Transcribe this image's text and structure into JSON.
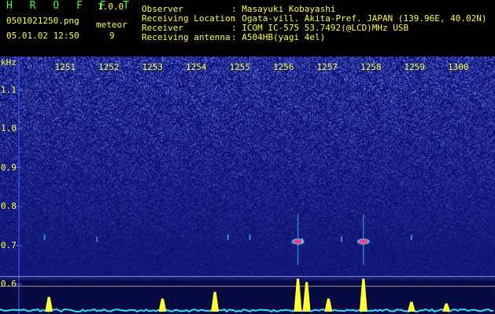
{
  "header": {
    "app_name": "H R O F F T",
    "version": "1.0.0",
    "filename": "0501021250.png",
    "datetime": "05.01.02 12:50",
    "meteor_label": "meteor",
    "meteor_count": "9"
  },
  "info": [
    {
      "label": "Observer",
      "value": ": Masayuki Kobayashi"
    },
    {
      "label": "Receiving Location",
      "value": ": Ogata-vill. Akita-Pref. JAPAN (139.96E, 40.02N)"
    },
    {
      "label": "Receiver",
      "value": ": ICOM IC-575 53.7492(@LCD)MHz USB"
    },
    {
      "label": "Receiving antenna",
      "value": ": A504HB(yagi 4el)"
    }
  ],
  "spectrogram": {
    "unit": "kHz",
    "time_ticks": [
      "1251",
      "1252",
      "1253",
      "1254",
      "1255",
      "1256",
      "1257",
      "1258",
      "1259",
      "1300"
    ],
    "freq_ticks": [
      {
        "label": "1.1",
        "value": 1.1
      },
      {
        "label": "1.0",
        "value": 1.0
      },
      {
        "label": "0.9",
        "value": 0.9
      },
      {
        "label": "0.8",
        "value": 0.8
      },
      {
        "label": "0.7",
        "value": 0.7
      },
      {
        "label": "0.6",
        "value": 0.6
      }
    ],
    "time_range": [
      1250,
      1300
    ],
    "freq_range": [
      0.58,
      1.17
    ],
    "colors": {
      "background": "#000000",
      "noise_dark": "#0a0e6e",
      "noise_light": "#6f86ff",
      "grid": "#4466ff",
      "meteor_core": "#ff3c78",
      "meteor_halo": "#58d8ff",
      "amplitude": "#ffff33",
      "baseline": "#33e0ff",
      "tick_text": "#ffff33"
    },
    "meteors": [
      {
        "time": 1256.1,
        "freq": 0.71,
        "strength": 1.0
      },
      {
        "time": 1257.6,
        "freq": 0.71,
        "strength": 1.0
      },
      {
        "time": 1256.2,
        "freq": 0.71,
        "strength": 0.4
      },
      {
        "time": 1254.5,
        "freq": 0.72,
        "strength": 0.2
      },
      {
        "time": 1250.3,
        "freq": 0.72,
        "strength": 0.2
      },
      {
        "time": 1258.7,
        "freq": 0.72,
        "strength": 0.2
      },
      {
        "time": 1257.1,
        "freq": 0.715,
        "strength": 0.15
      },
      {
        "time": 1255.0,
        "freq": 0.72,
        "strength": 0.15
      },
      {
        "time": 1251.5,
        "freq": 0.715,
        "strength": 0.1
      }
    ],
    "amplitude_peaks": [
      {
        "time": 1250.4,
        "height": 0.45
      },
      {
        "time": 1253.0,
        "height": 0.4
      },
      {
        "time": 1254.2,
        "height": 0.6
      },
      {
        "time": 1256.1,
        "height": 1.0
      },
      {
        "time": 1256.3,
        "height": 0.9
      },
      {
        "time": 1256.8,
        "height": 0.4
      },
      {
        "time": 1257.6,
        "height": 1.0
      },
      {
        "time": 1258.7,
        "height": 0.3
      },
      {
        "time": 1259.5,
        "height": 0.25
      }
    ],
    "reference_lines": [
      0.62,
      0.595
    ]
  }
}
